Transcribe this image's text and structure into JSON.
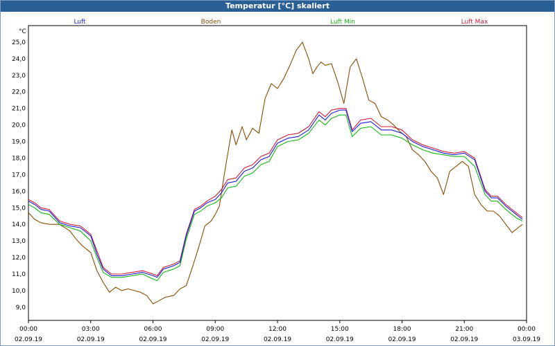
{
  "window": {
    "title": "Temperatur [°C] skaliert"
  },
  "chart_data": {
    "type": "line",
    "title": "Temperatur [°C] skaliert",
    "ylabel": "°C",
    "xlabel": "",
    "ylim": [
      8.2,
      26.0
    ],
    "xlim": [
      0,
      24
    ],
    "grid": true,
    "legend_placement": "top",
    "yticks": [
      "9,0",
      "10,0",
      "11,0",
      "12,0",
      "13,0",
      "14,0",
      "15,0",
      "16,0",
      "17,0",
      "18,0",
      "19,0",
      "20,0",
      "21,0",
      "22,0",
      "23,0",
      "24,0",
      "25,0"
    ],
    "xticks": [
      {
        "time": "00:00",
        "date": "02.09.19"
      },
      {
        "time": "03:00",
        "date": "02.09.19"
      },
      {
        "time": "06:00",
        "date": "02.09.19"
      },
      {
        "time": "09:00",
        "date": "02.09.19"
      },
      {
        "time": "12:00",
        "date": "02.09.19"
      },
      {
        "time": "15:00",
        "date": "02.09.19"
      },
      {
        "time": "18:00",
        "date": "02.09.19"
      },
      {
        "time": "21:00",
        "date": "02.09.19"
      },
      {
        "time": "00:00",
        "date": "03.09.19"
      }
    ],
    "series": [
      {
        "name": "Luft",
        "color": "#1a1adb",
        "x": [
          0,
          0.3,
          0.6,
          1,
          1.5,
          2,
          2.5,
          3,
          3.3,
          3.6,
          4,
          4.5,
          5,
          5.5,
          6,
          6.2,
          6.5,
          7,
          7.3,
          7.6,
          8,
          8.3,
          8.6,
          9,
          9.3,
          9.6,
          10,
          10.4,
          10.8,
          11.2,
          11.6,
          12,
          12.5,
          13,
          13.5,
          14,
          14.3,
          14.6,
          15,
          15.3,
          15.6,
          16,
          16.5,
          17,
          17.5,
          18,
          18.5,
          19,
          19.5,
          20,
          20.5,
          21,
          21.5,
          22,
          22.3,
          22.6,
          23,
          23.5,
          23.8
        ],
        "values": [
          15.4,
          15.2,
          14.9,
          14.8,
          14.1,
          13.9,
          13.8,
          13.3,
          12.2,
          11.3,
          10.9,
          10.9,
          11.0,
          11.1,
          10.9,
          10.8,
          11.3,
          11.5,
          11.7,
          13.3,
          14.8,
          15.0,
          15.3,
          15.5,
          15.9,
          16.5,
          16.6,
          17.2,
          17.4,
          17.9,
          18.1,
          18.9,
          19.2,
          19.3,
          19.7,
          20.6,
          20.3,
          20.7,
          20.9,
          20.9,
          19.6,
          20.1,
          20.2,
          19.7,
          19.7,
          19.5,
          19.0,
          18.7,
          18.5,
          18.3,
          18.2,
          18.3,
          17.9,
          16.0,
          15.6,
          15.6,
          15.1,
          14.6,
          14.3
        ]
      },
      {
        "name": "Boden",
        "color": "#8b4a00",
        "x": [
          0,
          0.3,
          0.6,
          1,
          1.5,
          2,
          2.3,
          2.6,
          3,
          3.3,
          3.6,
          3.9,
          4.2,
          4.5,
          4.8,
          5.1,
          5.4,
          5.7,
          6,
          6.3,
          6.6,
          7,
          7.3,
          7.6,
          7.9,
          8.2,
          8.5,
          8.8,
          9.0,
          9.2,
          9.5,
          9.8,
          10.0,
          10.3,
          10.5,
          10.8,
          11.1,
          11.4,
          11.7,
          12,
          12.3,
          12.6,
          12.9,
          13.2,
          13.5,
          13.7,
          13.9,
          14.1,
          14.3,
          14.6,
          14.9,
          15.2,
          15.5,
          15.8,
          16.1,
          16.4,
          16.7,
          17.0,
          17.3,
          17.6,
          17.9,
          18.2,
          18.5,
          18.8,
          19.1,
          19.4,
          19.7,
          20.0,
          20.3,
          20.6,
          20.9,
          21.2,
          21.5,
          21.8,
          22.1,
          22.4,
          22.7,
          23.0,
          23.3,
          23.6,
          23.8
        ],
        "values": [
          14.7,
          14.3,
          14.1,
          14.0,
          14.0,
          13.6,
          13.1,
          12.7,
          12.3,
          11.2,
          10.5,
          9.9,
          10.2,
          10.0,
          10.1,
          10.0,
          9.9,
          9.7,
          9.2,
          9.4,
          9.6,
          9.7,
          10.1,
          10.3,
          11.4,
          12.6,
          13.9,
          14.2,
          14.6,
          15.1,
          17.5,
          19.7,
          18.8,
          19.9,
          19.1,
          19.8,
          19.5,
          21.6,
          22.5,
          22.2,
          22.8,
          23.6,
          24.5,
          25.0,
          24.0,
          23.1,
          23.5,
          23.8,
          23.6,
          23.7,
          22.6,
          21.3,
          23.5,
          24.0,
          22.8,
          21.5,
          21.3,
          20.5,
          20.3,
          20.0,
          19.6,
          19.3,
          18.5,
          18.2,
          17.8,
          17.2,
          16.8,
          15.8,
          17.2,
          17.5,
          17.8,
          17.5,
          15.8,
          15.2,
          14.8,
          14.8,
          14.5,
          14.0,
          13.5,
          13.8,
          14.0
        ]
      },
      {
        "name": "Luft Min",
        "color": "#12b812",
        "x": [
          0,
          0.3,
          0.6,
          1,
          1.5,
          2,
          2.5,
          3,
          3.3,
          3.6,
          4,
          4.5,
          5,
          5.5,
          6,
          6.2,
          6.5,
          7,
          7.3,
          7.6,
          8,
          8.3,
          8.6,
          9,
          9.3,
          9.6,
          10,
          10.4,
          10.8,
          11.2,
          11.6,
          12,
          12.5,
          13,
          13.5,
          14,
          14.3,
          14.6,
          15,
          15.3,
          15.6,
          16,
          16.5,
          17,
          17.5,
          18,
          18.5,
          19,
          19.5,
          20,
          20.5,
          21,
          21.5,
          22,
          22.3,
          22.6,
          23,
          23.5,
          23.8
        ],
        "values": [
          15.2,
          15.0,
          14.7,
          14.6,
          14.0,
          13.8,
          13.6,
          13.0,
          12.0,
          11.1,
          10.8,
          10.8,
          10.9,
          11.0,
          10.7,
          10.6,
          11.1,
          11.3,
          11.5,
          13.1,
          14.6,
          14.8,
          15.1,
          15.3,
          15.6,
          16.2,
          16.3,
          16.9,
          17.1,
          17.6,
          17.8,
          18.7,
          19.0,
          19.1,
          19.5,
          20.3,
          20.0,
          20.4,
          20.6,
          20.6,
          19.3,
          19.8,
          19.9,
          19.4,
          19.4,
          19.2,
          18.8,
          18.5,
          18.3,
          18.2,
          18.1,
          18.1,
          17.5,
          15.8,
          15.4,
          15.4,
          14.9,
          14.4,
          14.2
        ]
      },
      {
        "name": "Luft Max",
        "color": "#cc1a3a",
        "x": [
          0,
          0.3,
          0.6,
          1,
          1.5,
          2,
          2.5,
          3,
          3.3,
          3.6,
          4,
          4.5,
          5,
          5.5,
          6,
          6.2,
          6.5,
          7,
          7.3,
          7.6,
          8,
          8.3,
          8.6,
          9,
          9.3,
          9.6,
          10,
          10.4,
          10.8,
          11.2,
          11.6,
          12,
          12.5,
          13,
          13.5,
          14,
          14.3,
          14.6,
          15,
          15.3,
          15.6,
          16,
          16.5,
          17,
          17.5,
          18,
          18.5,
          19,
          19.5,
          20,
          20.5,
          21,
          21.5,
          22,
          22.3,
          22.6,
          23,
          23.5,
          23.8
        ],
        "values": [
          15.5,
          15.3,
          15.0,
          14.9,
          14.2,
          14.0,
          13.9,
          13.4,
          12.4,
          11.4,
          11.0,
          11.0,
          11.1,
          11.2,
          11.0,
          10.9,
          11.4,
          11.6,
          11.8,
          13.4,
          14.9,
          15.1,
          15.4,
          15.7,
          16.1,
          16.7,
          16.8,
          17.4,
          17.6,
          18.1,
          18.3,
          19.1,
          19.4,
          19.5,
          19.9,
          20.8,
          20.5,
          20.9,
          21.0,
          21.0,
          19.7,
          20.3,
          20.4,
          19.9,
          19.9,
          19.7,
          19.1,
          18.8,
          18.6,
          18.4,
          18.3,
          18.4,
          18.0,
          16.1,
          15.7,
          15.7,
          15.2,
          14.7,
          14.4
        ]
      }
    ]
  }
}
